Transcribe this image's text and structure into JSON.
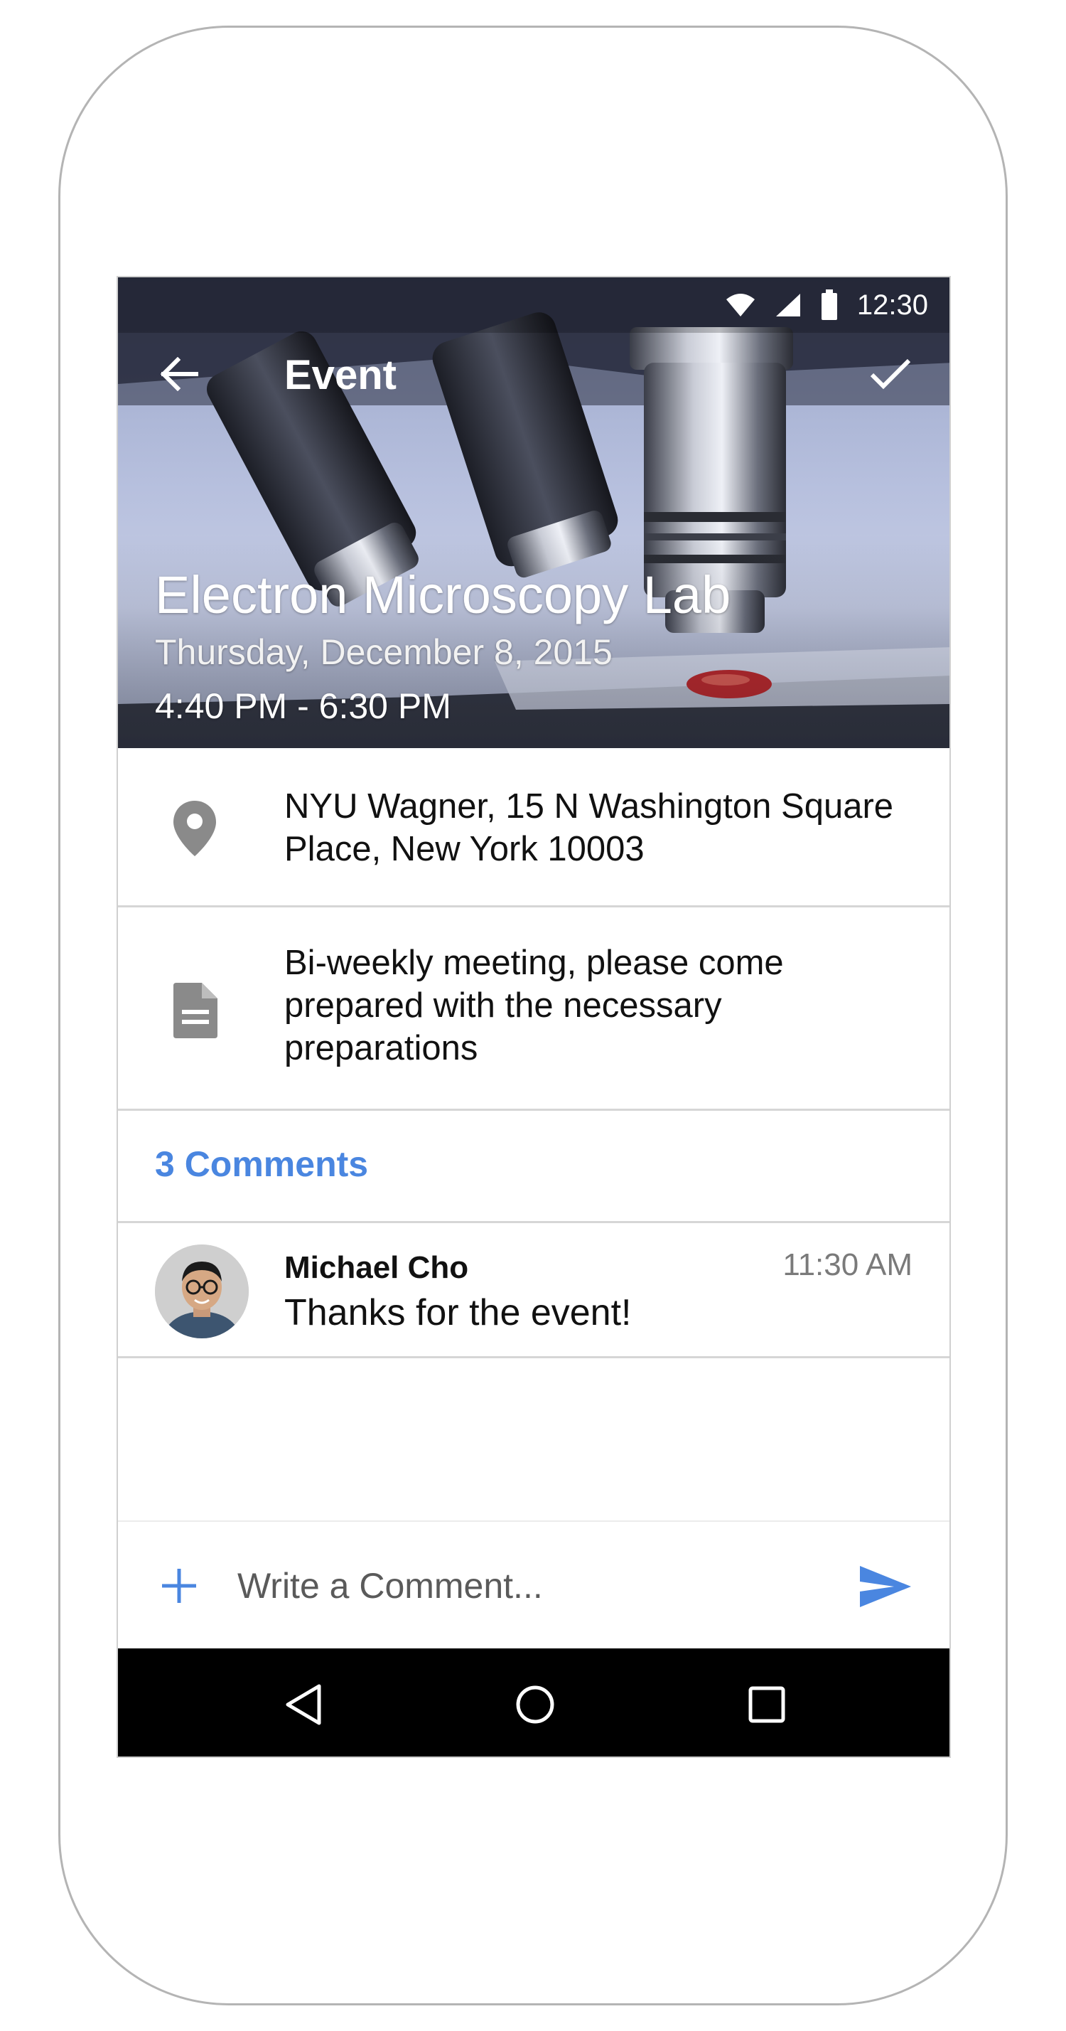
{
  "status_bar": {
    "time": "12:30"
  },
  "app_bar": {
    "title": "Event"
  },
  "event": {
    "title": "Electron Microscopy Lab",
    "date": "Thursday, December 8, 2015",
    "time": "4:40 PM - 6:30 PM",
    "location": "NYU Wagner, 15 N Washington Square Place, New York 10003",
    "description": "Bi-weekly meeting, please come prepared with the necessary preparations"
  },
  "comments": {
    "count_label": "3 Comments",
    "items": [
      {
        "author": "Michael Cho",
        "time": "11:30 AM",
        "text": "Thanks for the event!"
      }
    ]
  },
  "compose": {
    "placeholder": "Write a Comment..."
  },
  "icons": {
    "back": "arrow-back-icon",
    "confirm": "check-icon",
    "location": "location-pin-icon",
    "description": "document-icon",
    "add": "plus-icon",
    "send": "send-icon",
    "nav": [
      "nav-back-icon",
      "nav-home-icon",
      "nav-recents-icon"
    ]
  },
  "colors": {
    "accent": "#4a86e0",
    "icon_gray": "#8a8a8a",
    "divider": "#d6d6d6",
    "nav_bar": "#000000"
  }
}
